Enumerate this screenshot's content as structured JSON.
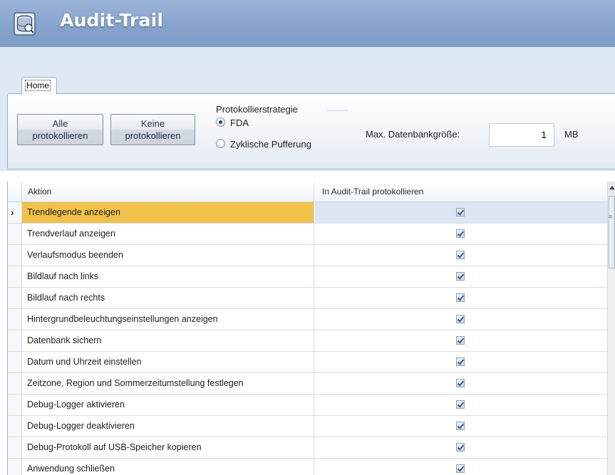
{
  "window": {
    "title": "Audit-Trail",
    "app_icon": "database-icon"
  },
  "ribbon": {
    "tabs": [
      {
        "label": "Home",
        "active": true
      }
    ],
    "buttons": {
      "log_all": {
        "line1": "Alle",
        "line2": "protokollieren"
      },
      "log_none": {
        "line1": "Keine",
        "line2": "protokollieren"
      }
    },
    "strategy": {
      "label": "Protokollierstrategie",
      "options": [
        {
          "label": "FDA",
          "selected": true
        },
        {
          "label": "Zyklische Pufferung",
          "selected": false
        }
      ]
    },
    "max_db": {
      "label": "Max. Datenbankgröße:",
      "value": "1",
      "unit": "MB"
    }
  },
  "grid": {
    "columns": [
      "Aktion",
      "In Audit-Trail protokollieren"
    ],
    "current_row_marker": "›",
    "rows": [
      {
        "aktion": "Trendlegende anzeigen",
        "checked": true,
        "selected": true
      },
      {
        "aktion": "Trendverlauf anzeigen",
        "checked": true
      },
      {
        "aktion": "Verlaufsmodus beenden",
        "checked": true
      },
      {
        "aktion": "Bildlauf nach links",
        "checked": true
      },
      {
        "aktion": "Bildlauf nach rechts",
        "checked": true
      },
      {
        "aktion": "Hintergrundbeleuchtungseinstellungen anzeigen",
        "checked": true
      },
      {
        "aktion": "Datenbank sichern",
        "checked": true
      },
      {
        "aktion": "Datum und Uhrzeit einstellen",
        "checked": true
      },
      {
        "aktion": "Zeitzone, Region und Sommerzeitumstellung festlegen",
        "checked": true
      },
      {
        "aktion": "Debug-Logger aktivieren",
        "checked": true
      },
      {
        "aktion": "Debug-Logger deaktivieren",
        "checked": true
      },
      {
        "aktion": "Debug-Protokoll auf USB-Speicher kopieren",
        "checked": true
      },
      {
        "aktion": "Anwendung schließen",
        "checked": true
      }
    ]
  },
  "colors": {
    "title_bar": "#86a3cd",
    "selected_cell": "#f1c14a",
    "selected_row": "#dde6f5",
    "ribbon_bg": "#dfe9f5"
  }
}
